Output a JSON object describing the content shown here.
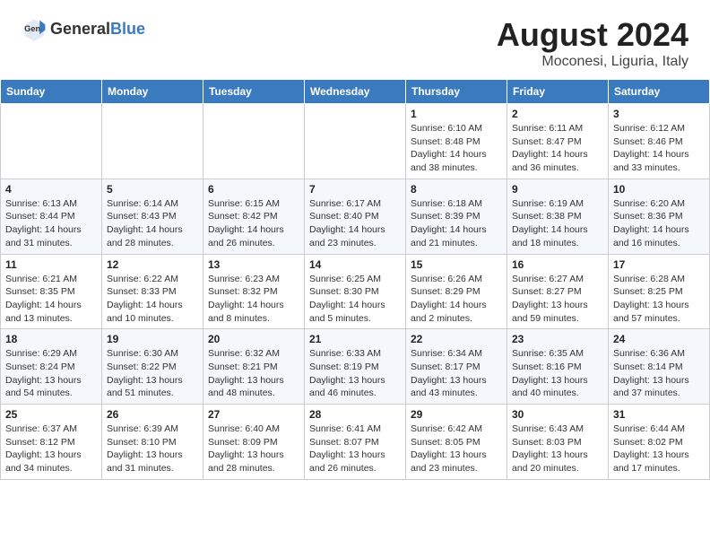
{
  "header": {
    "logo_general": "General",
    "logo_blue": "Blue",
    "month_year": "August 2024",
    "location": "Moconesi, Liguria, Italy"
  },
  "weekdays": [
    "Sunday",
    "Monday",
    "Tuesday",
    "Wednesday",
    "Thursday",
    "Friday",
    "Saturday"
  ],
  "weeks": [
    [
      {
        "day": "",
        "info": ""
      },
      {
        "day": "",
        "info": ""
      },
      {
        "day": "",
        "info": ""
      },
      {
        "day": "",
        "info": ""
      },
      {
        "day": "1",
        "info": "Sunrise: 6:10 AM\nSunset: 8:48 PM\nDaylight: 14 hours\nand 38 minutes."
      },
      {
        "day": "2",
        "info": "Sunrise: 6:11 AM\nSunset: 8:47 PM\nDaylight: 14 hours\nand 36 minutes."
      },
      {
        "day": "3",
        "info": "Sunrise: 6:12 AM\nSunset: 8:46 PM\nDaylight: 14 hours\nand 33 minutes."
      }
    ],
    [
      {
        "day": "4",
        "info": "Sunrise: 6:13 AM\nSunset: 8:44 PM\nDaylight: 14 hours\nand 31 minutes."
      },
      {
        "day": "5",
        "info": "Sunrise: 6:14 AM\nSunset: 8:43 PM\nDaylight: 14 hours\nand 28 minutes."
      },
      {
        "day": "6",
        "info": "Sunrise: 6:15 AM\nSunset: 8:42 PM\nDaylight: 14 hours\nand 26 minutes."
      },
      {
        "day": "7",
        "info": "Sunrise: 6:17 AM\nSunset: 8:40 PM\nDaylight: 14 hours\nand 23 minutes."
      },
      {
        "day": "8",
        "info": "Sunrise: 6:18 AM\nSunset: 8:39 PM\nDaylight: 14 hours\nand 21 minutes."
      },
      {
        "day": "9",
        "info": "Sunrise: 6:19 AM\nSunset: 8:38 PM\nDaylight: 14 hours\nand 18 minutes."
      },
      {
        "day": "10",
        "info": "Sunrise: 6:20 AM\nSunset: 8:36 PM\nDaylight: 14 hours\nand 16 minutes."
      }
    ],
    [
      {
        "day": "11",
        "info": "Sunrise: 6:21 AM\nSunset: 8:35 PM\nDaylight: 14 hours\nand 13 minutes."
      },
      {
        "day": "12",
        "info": "Sunrise: 6:22 AM\nSunset: 8:33 PM\nDaylight: 14 hours\nand 10 minutes."
      },
      {
        "day": "13",
        "info": "Sunrise: 6:23 AM\nSunset: 8:32 PM\nDaylight: 14 hours\nand 8 minutes."
      },
      {
        "day": "14",
        "info": "Sunrise: 6:25 AM\nSunset: 8:30 PM\nDaylight: 14 hours\nand 5 minutes."
      },
      {
        "day": "15",
        "info": "Sunrise: 6:26 AM\nSunset: 8:29 PM\nDaylight: 14 hours\nand 2 minutes."
      },
      {
        "day": "16",
        "info": "Sunrise: 6:27 AM\nSunset: 8:27 PM\nDaylight: 13 hours\nand 59 minutes."
      },
      {
        "day": "17",
        "info": "Sunrise: 6:28 AM\nSunset: 8:25 PM\nDaylight: 13 hours\nand 57 minutes."
      }
    ],
    [
      {
        "day": "18",
        "info": "Sunrise: 6:29 AM\nSunset: 8:24 PM\nDaylight: 13 hours\nand 54 minutes."
      },
      {
        "day": "19",
        "info": "Sunrise: 6:30 AM\nSunset: 8:22 PM\nDaylight: 13 hours\nand 51 minutes."
      },
      {
        "day": "20",
        "info": "Sunrise: 6:32 AM\nSunset: 8:21 PM\nDaylight: 13 hours\nand 48 minutes."
      },
      {
        "day": "21",
        "info": "Sunrise: 6:33 AM\nSunset: 8:19 PM\nDaylight: 13 hours\nand 46 minutes."
      },
      {
        "day": "22",
        "info": "Sunrise: 6:34 AM\nSunset: 8:17 PM\nDaylight: 13 hours\nand 43 minutes."
      },
      {
        "day": "23",
        "info": "Sunrise: 6:35 AM\nSunset: 8:16 PM\nDaylight: 13 hours\nand 40 minutes."
      },
      {
        "day": "24",
        "info": "Sunrise: 6:36 AM\nSunset: 8:14 PM\nDaylight: 13 hours\nand 37 minutes."
      }
    ],
    [
      {
        "day": "25",
        "info": "Sunrise: 6:37 AM\nSunset: 8:12 PM\nDaylight: 13 hours\nand 34 minutes."
      },
      {
        "day": "26",
        "info": "Sunrise: 6:39 AM\nSunset: 8:10 PM\nDaylight: 13 hours\nand 31 minutes."
      },
      {
        "day": "27",
        "info": "Sunrise: 6:40 AM\nSunset: 8:09 PM\nDaylight: 13 hours\nand 28 minutes."
      },
      {
        "day": "28",
        "info": "Sunrise: 6:41 AM\nSunset: 8:07 PM\nDaylight: 13 hours\nand 26 minutes."
      },
      {
        "day": "29",
        "info": "Sunrise: 6:42 AM\nSunset: 8:05 PM\nDaylight: 13 hours\nand 23 minutes."
      },
      {
        "day": "30",
        "info": "Sunrise: 6:43 AM\nSunset: 8:03 PM\nDaylight: 13 hours\nand 20 minutes."
      },
      {
        "day": "31",
        "info": "Sunrise: 6:44 AM\nSunset: 8:02 PM\nDaylight: 13 hours\nand 17 minutes."
      }
    ]
  ]
}
